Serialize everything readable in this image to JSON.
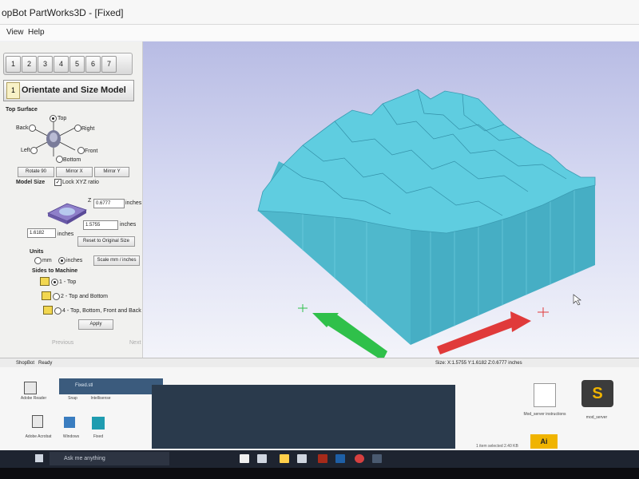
{
  "window": {
    "title": "opBot PartWorks3D - [Fixed]"
  },
  "menu": {
    "view": "View",
    "help": "Help"
  },
  "steps": [
    "1",
    "2",
    "3",
    "4",
    "5",
    "6",
    "7"
  ],
  "panel": {
    "step_number": "1",
    "header": "Orientate and Size Model",
    "top_surface": {
      "label": "Top Surface",
      "top": "Top",
      "back": "Back",
      "right": "Right",
      "left": "Left",
      "front": "Front",
      "bottom": "Bottom",
      "selected": "Top"
    },
    "buttons": {
      "rotate": "Rotate 90",
      "mirror_x": "Mirror X",
      "mirror_y": "Mirror Y"
    },
    "model_size": {
      "label": "Model Size",
      "lock_label": "Lock XYZ ratio",
      "lock_checked": true,
      "z_axis": "Z",
      "z_value": "0.6777",
      "y_value": "1.5755",
      "x_value": "1.6182",
      "unit": "inches",
      "reset": "Reset to Original Size"
    },
    "units": {
      "label": "Units",
      "mm": "mm",
      "inches": "inches",
      "selected": "inches",
      "scale": "Scale mm / inches"
    },
    "sides": {
      "label": "Sides to Machine",
      "options": [
        "1 - Top",
        "2 - Top and Bottom",
        "4 - Top, Bottom, Front and Back"
      ],
      "selected": "1 - Top"
    },
    "apply": "Apply",
    "previous": "Previous",
    "next": "Next"
  },
  "viewport": {
    "colors": {
      "model": "#5fcde0",
      "x_arrow": "#e03a3a",
      "y_arrow": "#2fc04a"
    }
  },
  "status": {
    "left_tab": "ShopBot",
    "ready": "Ready",
    "size": "Size: X:1.5755 Y:1.6182 Z:0.6777 inches"
  },
  "desktop": {
    "explorer_name": "Fixed.stl",
    "icons": [
      "Adobe Reader",
      "Snap",
      "Intellisense",
      "Adobe Acrobat",
      "Windows",
      "Fixed",
      "Mod_server instructions",
      "mod_server"
    ],
    "selection_text": "1 item selected  2.40 KB"
  },
  "taskbar": {
    "search_placeholder": "Ask me anything"
  }
}
